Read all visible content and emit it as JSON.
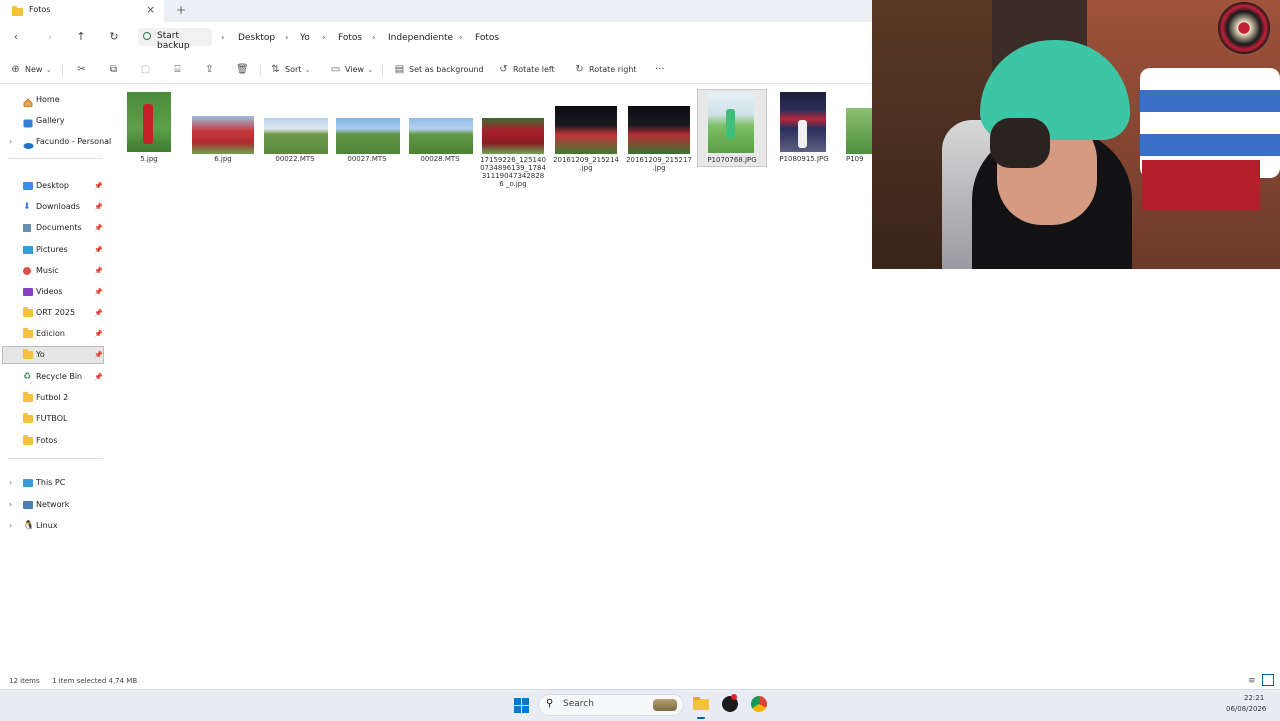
{
  "window": {
    "tab_title": "Fotos",
    "new_tab": "+",
    "close_tab": "×"
  },
  "nav": {
    "back": "‹",
    "forward": "›",
    "up": "↑",
    "refresh": "↻",
    "start_backup": "Start backup",
    "breadcrumbs": [
      "Desktop",
      "Yo",
      "Fotos",
      "Independiente",
      "Fotos"
    ],
    "separator": "›"
  },
  "toolbar": {
    "new": "New",
    "sort": "Sort",
    "view": "View",
    "set_background": "Set as background",
    "rotate_left": "Rotate left",
    "rotate_right": "Rotate right",
    "more": "···"
  },
  "sidebar": {
    "top": [
      {
        "label": "Home",
        "icon": "home-icon"
      },
      {
        "label": "Gallery",
        "icon": "gallery-icon"
      },
      {
        "label": "Facundo - Personal",
        "icon": "cloud-icon"
      }
    ],
    "pinned": [
      {
        "label": "Desktop",
        "icon": "desktop-icon"
      },
      {
        "label": "Downloads",
        "icon": "download-icon"
      },
      {
        "label": "Documents",
        "icon": "document-icon"
      },
      {
        "label": "Pictures",
        "icon": "pictures-icon"
      },
      {
        "label": "Music",
        "icon": "music-icon"
      },
      {
        "label": "Videos",
        "icon": "video-icon"
      },
      {
        "label": "ORT 2025",
        "icon": "folder-icon"
      },
      {
        "label": "Edicion",
        "icon": "folder-icon"
      },
      {
        "label": "Yo",
        "icon": "folder-icon"
      },
      {
        "label": "Recycle Bin",
        "icon": "recycle-bin-icon"
      },
      {
        "label": "Futbol 2",
        "icon": "folder-icon"
      },
      {
        "label": "FUTBOL",
        "icon": "folder-icon"
      },
      {
        "label": "Fotos",
        "icon": "folder-icon"
      }
    ],
    "bottom": [
      {
        "label": "This PC",
        "icon": "computer-icon"
      },
      {
        "label": "Network",
        "icon": "network-icon"
      },
      {
        "label": "Linux",
        "icon": "linux-icon"
      }
    ],
    "selected": "Yo"
  },
  "files": [
    {
      "name": "5.jpg"
    },
    {
      "name": "6.jpg"
    },
    {
      "name": "00022.MTS"
    },
    {
      "name": "00027.MTS"
    },
    {
      "name": "00028.MTS"
    },
    {
      "name": "17159226_125140 0734896139_1784 311190473428286 _o.jpg"
    },
    {
      "name": "20161209_215214 .jpg"
    },
    {
      "name": "20161209_215217 .jpg"
    },
    {
      "name": "P1070768.JPG"
    },
    {
      "name": "P1080915.JPG"
    },
    {
      "name": "P109"
    }
  ],
  "status": {
    "items": "12 items",
    "selected": "1 item selected  4,74 MB"
  },
  "taskbar": {
    "search": "Search",
    "time": "22:21",
    "date": "06/08/2026"
  },
  "colors": {
    "accent": "#0067c0",
    "folder": "#f3c13a",
    "selection": "#e6e6e6"
  }
}
